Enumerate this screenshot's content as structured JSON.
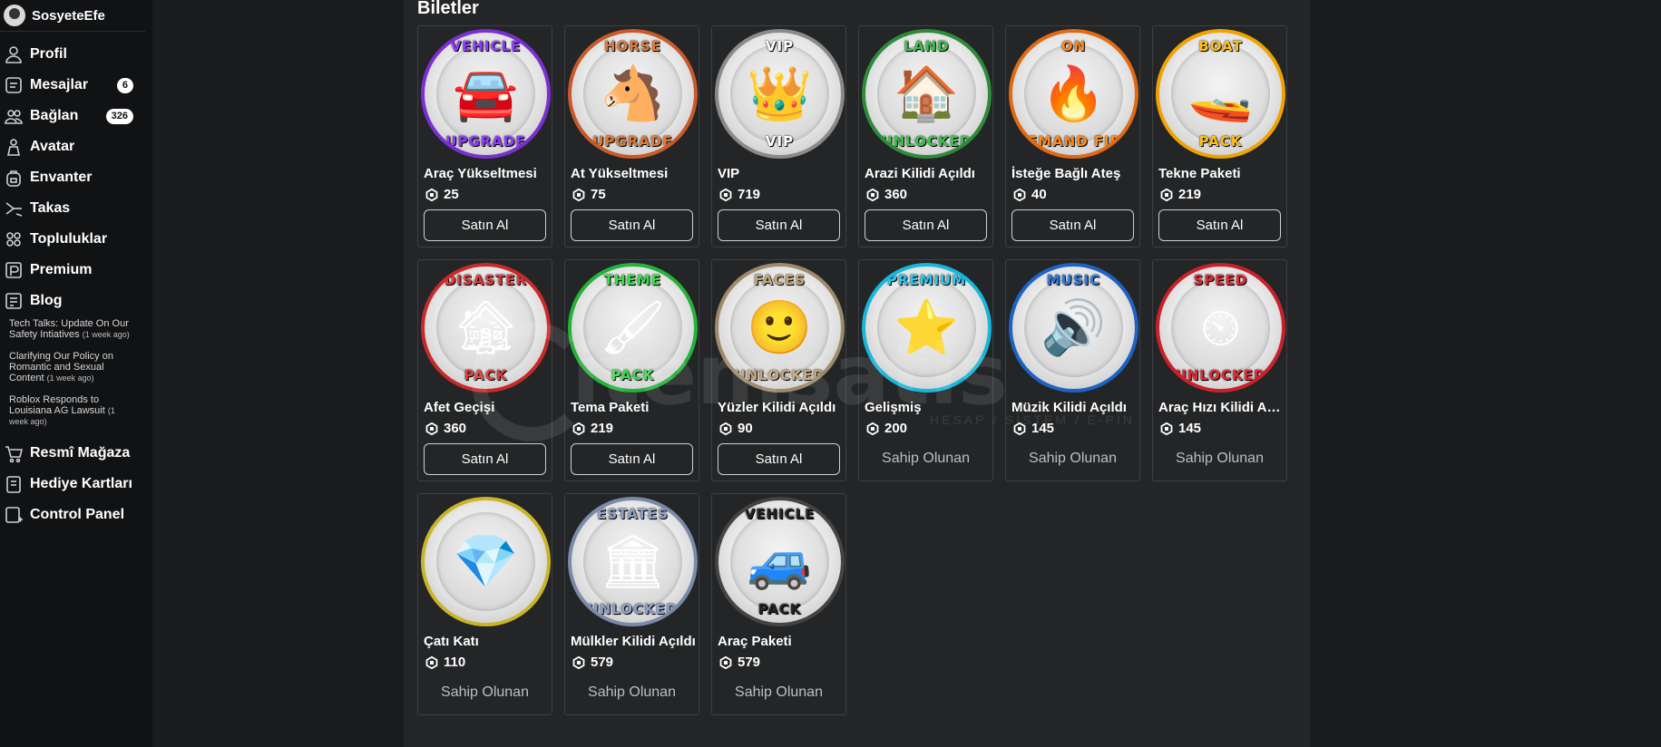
{
  "user": {
    "name": "SosyeteEfe"
  },
  "nav": [
    {
      "key": "profile",
      "label": "Profil",
      "icon": "person-icon"
    },
    {
      "key": "messages",
      "label": "Mesajlar",
      "icon": "message-icon",
      "badge": "6"
    },
    {
      "key": "connect",
      "label": "Bağlan",
      "icon": "friends-icon",
      "badge": "326"
    },
    {
      "key": "avatar",
      "label": "Avatar",
      "icon": "avatar-icon"
    },
    {
      "key": "inventory",
      "label": "Envanter",
      "icon": "backpack-icon"
    },
    {
      "key": "trade",
      "label": "Takas",
      "icon": "trade-icon"
    },
    {
      "key": "groups",
      "label": "Topluluklar",
      "icon": "groups-icon"
    },
    {
      "key": "premium",
      "label": "Premium",
      "icon": "premium-icon"
    },
    {
      "key": "blog",
      "label": "Blog",
      "icon": "blog-icon"
    }
  ],
  "blog_posts": [
    {
      "title": "Tech Talks: Update On Our Safety Intiatives",
      "ago": "(1 week ago)"
    },
    {
      "title": "Clarifying Our Policy on Romantic and Sexual Content",
      "ago": "(1 week ago)"
    },
    {
      "title": "Roblox Responds to Louisiana AG Lawsuit",
      "ago": "(1 week ago)"
    }
  ],
  "nav_bottom": [
    {
      "key": "store",
      "label": "Resmî Mağaza",
      "icon": "cart-icon"
    },
    {
      "key": "giftcards",
      "label": "Hediye Kartları",
      "icon": "giftcard-icon"
    },
    {
      "key": "control",
      "label": "Control Panel",
      "icon": "control-panel-icon"
    }
  ],
  "section_title": "Biletler",
  "buy_label": "Satın Al",
  "owned_label": "Sahip Olunan",
  "watermark": {
    "text": "itemsatis",
    "sub": "HESAP / SİSTEM / E-PİN"
  },
  "passes": [
    {
      "name": "Araç Yükseltmesi",
      "price": "25",
      "state": "buy",
      "top": "VEHICLE",
      "bottom": "UPGRADE",
      "ring": "#7b2fd0",
      "art": "🚘",
      "top_color": "#8d3cff"
    },
    {
      "name": "At Yükseltmesi",
      "price": "75",
      "state": "buy",
      "top": "HORSE",
      "bottom": "UPGRADE",
      "ring": "#c85a2a",
      "art": "🐴",
      "top_color": "#e07a3a"
    },
    {
      "name": "VIP",
      "price": "719",
      "state": "buy",
      "top": "VIP",
      "bottom": "VIP",
      "ring": "#8a8a8a",
      "art": "👑",
      "top_color": "#ffffff"
    },
    {
      "name": "Arazi Kilidi Açıldı",
      "price": "360",
      "state": "buy",
      "top": "LAND",
      "bottom": "UNLOCKED",
      "ring": "#2e8b3a",
      "art": "🏠",
      "top_color": "#3fc24f"
    },
    {
      "name": "İsteğe Bağlı Ateş",
      "price": "40",
      "state": "buy",
      "top": "ON",
      "bottom": "DEMAND FIRE",
      "ring": "#e06a12",
      "art": "🔥",
      "top_color": "#ff8a1a"
    },
    {
      "name": "Tekne Paketi",
      "price": "219",
      "state": "buy",
      "top": "BOAT",
      "bottom": "PACK",
      "ring": "#f0a300",
      "art": "🚤",
      "top_color": "#ffbf1a"
    },
    {
      "name": "Afet Geçişi",
      "price": "360",
      "state": "buy",
      "top": "DISASTER",
      "bottom": "PACK",
      "ring": "#c82a2a",
      "art": "🏚",
      "top_color": "#e03a3a"
    },
    {
      "name": "Tema Paketi",
      "price": "219",
      "state": "buy",
      "top": "THEME",
      "bottom": "PACK",
      "ring": "#24b23a",
      "art": "🖌",
      "top_color": "#3ddc4f"
    },
    {
      "name": "Yüzler Kilidi Açıldı",
      "price": "90",
      "state": "buy",
      "top": "FACES",
      "bottom": "UNLOCKED",
      "ring": "#9c8a6a",
      "art": "🙂",
      "top_color": "#c2a97a"
    },
    {
      "name": "Gelişmiş",
      "price": "200",
      "state": "owned",
      "top": "PREMIUM",
      "bottom": "",
      "ring": "#18b6d8",
      "art": "⭐",
      "top_color": "#2cc8ee"
    },
    {
      "name": "Müzik Kilidi Açıldı",
      "price": "145",
      "state": "owned",
      "top": "MUSIC",
      "bottom": "",
      "ring": "#1f62c4",
      "art": "🔊",
      "top_color": "#2f7be0"
    },
    {
      "name": "Araç Hızı Kilidi Açıldı",
      "price": "145",
      "state": "owned",
      "top": "SPEED",
      "bottom": "UNLOCKED",
      "ring": "#c8212a",
      "art": "⏲",
      "top_color": "#e02a35"
    },
    {
      "name": "Çatı Katı",
      "price": "110",
      "state": "owned",
      "top": "",
      "bottom": "",
      "ring": "#c8b52a",
      "art": "💎",
      "top_color": "#e0cc3a"
    },
    {
      "name": "Mülkler Kilidi Açıldı",
      "price": "579",
      "state": "owned",
      "top": "ESTATES",
      "bottom": "UNLOCKED",
      "ring": "#7a8aa8",
      "art": "🏛",
      "top_color": "#8fa2c8"
    },
    {
      "name": "Araç Paketi",
      "price": "579",
      "state": "owned",
      "top": "VEHICLE",
      "bottom": "PACK",
      "ring": "#444444",
      "art": "🚙",
      "top_color": "#222222"
    }
  ]
}
